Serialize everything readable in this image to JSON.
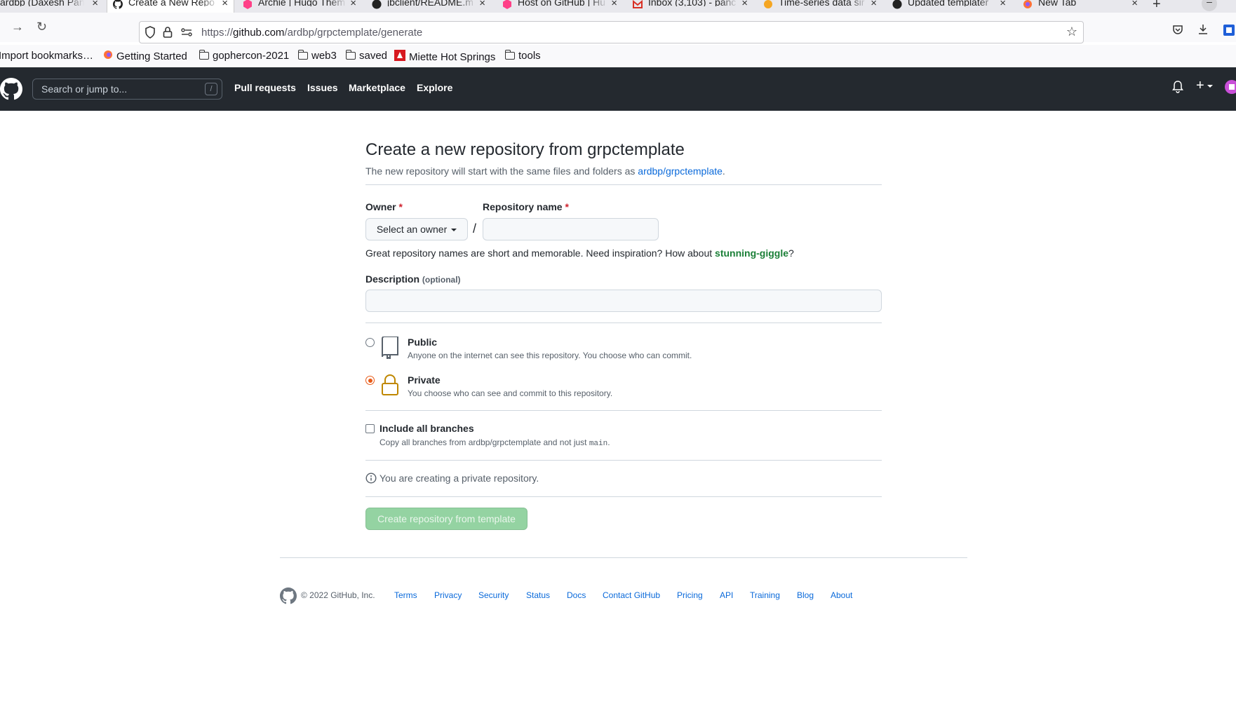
{
  "browser": {
    "tabs": [
      {
        "title": "ardbp (Daxesh Pan",
        "icon": "github-icon"
      },
      {
        "title": "Create a New Repo",
        "icon": "github-icon"
      },
      {
        "title": "Archie | Hugo Them",
        "icon": "hugo-icon"
      },
      {
        "title": "jbclient/README.m",
        "icon": "github-icon"
      },
      {
        "title": "Host on GitHub | Hu",
        "icon": "hugo-icon"
      },
      {
        "title": "Inbox (3,103) - panc",
        "icon": "gmail-icon"
      },
      {
        "title": "Time-series data sir",
        "icon": "tiger-icon"
      },
      {
        "title": "Updated templater",
        "icon": "github-icon"
      },
      {
        "title": "New Tab",
        "icon": "firefox-icon"
      }
    ],
    "close_glyph": "×",
    "new_tab_glyph": "+",
    "url_prefix": "https://",
    "url_domain": "github.com",
    "url_path": "/ardbp/grpctemplate/generate",
    "bookmarks": [
      {
        "label": "Import bookmarks…"
      },
      {
        "label": "Getting Started"
      },
      {
        "label": "gophercon-2021"
      },
      {
        "label": "web3"
      },
      {
        "label": "saved"
      },
      {
        "label": "Miette Hot Springs"
      },
      {
        "label": "tools"
      }
    ]
  },
  "header": {
    "search_placeholder": "Search or jump to...",
    "search_shortcut": "/",
    "nav": [
      "Pull requests",
      "Issues",
      "Marketplace",
      "Explore"
    ]
  },
  "form": {
    "title": "Create a new repository from grpctemplate",
    "subtitle_prefix": "The new repository will start with the same files and folders as ",
    "template_link": "ardbp/grpctemplate",
    "subtitle_suffix": ".",
    "owner_label": "Owner",
    "repo_label": "Repository name",
    "required_mark": "*",
    "owner_select": "Select an owner",
    "separator": "/",
    "repo_value": "",
    "hint_prefix": "Great repository names are short and memorable. Need inspiration? How about ",
    "hint_suggestion": "stunning-giggle",
    "hint_suffix": "?",
    "description_label": "Description",
    "description_optional": "(optional)",
    "description_value": "",
    "public_title": "Public",
    "public_desc": "Anyone on the internet can see this repository. You choose who can commit.",
    "private_title": "Private",
    "private_desc": "You choose who can see and commit to this repository.",
    "selected_visibility": "Private",
    "branches_title": "Include all branches",
    "branches_desc_prefix": "Copy all branches from ardbp/grpctemplate and not just ",
    "branches_desc_code": "main",
    "branches_desc_suffix": ".",
    "info_text": "You are creating a private repository.",
    "submit_label": "Create repository from template"
  },
  "footer": {
    "copyright": "© 2022 GitHub, Inc.",
    "links": [
      "Terms",
      "Privacy",
      "Security",
      "Status",
      "Docs",
      "Contact GitHub",
      "Pricing",
      "API",
      "Training",
      "Blog",
      "About"
    ]
  },
  "colors": {
    "header_bg": "#24292f",
    "link": "#0969da",
    "suggestion": "#1a7f37",
    "submit_disabled": "#94d3a2",
    "radio_checked": "#e85b18"
  }
}
